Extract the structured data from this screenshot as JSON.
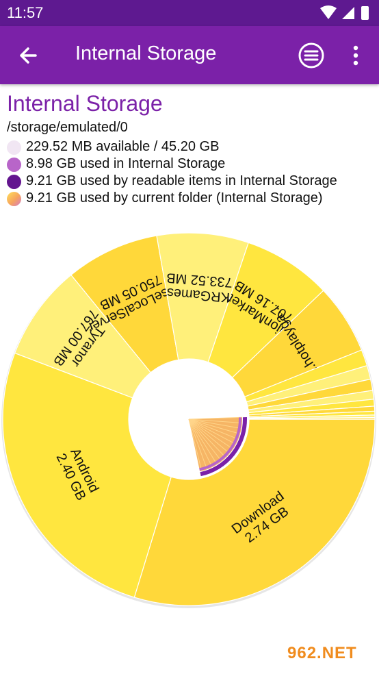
{
  "status_bar": {
    "time": "11:57"
  },
  "app_bar": {
    "title": "Internal Storage"
  },
  "storage": {
    "heading": "Internal Storage",
    "path": "/storage/emulated/0",
    "legend": [
      {
        "text": "229.52 MB available / 45.20 GB",
        "color": "#f1e6f3"
      },
      {
        "text": "8.98 GB used in Internal Storage",
        "color": "#b865c9"
      },
      {
        "text": "9.21 GB used by readable items in Internal Storage",
        "color": "#63158f"
      },
      {
        "text": "9.21 GB used by current folder (Internal Storage)",
        "color": "#f6a35e"
      }
    ]
  },
  "colors": {
    "status_bar": "#5e1990",
    "app_bar": "#7b21a8",
    "accent": "#7b21a8",
    "slice_dark": "#ffd83a",
    "slice_mid": "#ffe63f",
    "slice_light": "#fff07a"
  },
  "chart_data": {
    "type": "pie",
    "items": [
      {
        "name": "Download",
        "size": "2.74 GB",
        "value": 2740
      },
      {
        "name": "Android",
        "size": "2.40 GB",
        "value": 2400
      },
      {
        "name": "Tyranor",
        "size": "767.00 MB",
        "value": 767
      },
      {
        "name": "MuseLocalServer",
        "size": "750.05 MB",
        "value": 750.05
      },
      {
        "name": "KRGames",
        "size": "733.52 MB",
        "value": 733.52
      },
      {
        "name": "lionMarket",
        "size": "707.16 MB",
        "value": 707.16
      },
      {
        "name": "com.hotplayga...",
        "size": "",
        "value": 560
      },
      {
        "name": "",
        "size": "",
        "value": 130
      },
      {
        "name": "",
        "size": "",
        "value": 110
      },
      {
        "name": "",
        "size": "",
        "value": 90
      },
      {
        "name": "",
        "size": "",
        "value": 70
      },
      {
        "name": "",
        "size": "",
        "value": 55
      },
      {
        "name": "",
        "size": "",
        "value": 40
      },
      {
        "name": "",
        "size": "",
        "value": 30
      },
      {
        "name": "",
        "size": "",
        "value": 20
      },
      {
        "name": "",
        "size": "",
        "value": 13
      }
    ]
  },
  "watermark": {
    "text": "962.NET"
  }
}
